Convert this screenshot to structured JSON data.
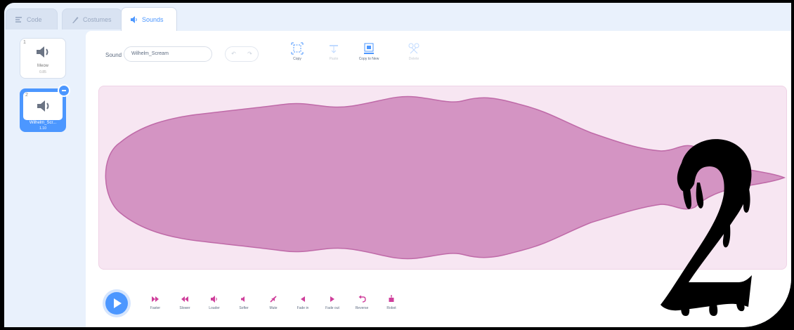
{
  "colors": {
    "accent": "#4c97ff",
    "wave_fill": "#d494c3",
    "wave_bg": "#f7e6f2",
    "effect_icon": "#cf3f9b"
  },
  "tabs": [
    {
      "label": "Code",
      "icon": "code-icon"
    },
    {
      "label": "Costumes",
      "icon": "brush-icon"
    },
    {
      "label": "Sounds",
      "icon": "speaker-icon",
      "active": true
    }
  ],
  "sound_list": [
    {
      "number": "1",
      "name": "Meow",
      "duration": "0.85"
    },
    {
      "number": "2",
      "name": "Wilhelm_Scr...",
      "duration": "1.10",
      "selected": true
    }
  ],
  "editor": {
    "sound_label": "Sound",
    "sound_name": "Wilhelm_Scream",
    "undo_glyph": "↶",
    "redo_glyph": "↷",
    "tools": [
      {
        "label": "Copy",
        "icon": "copy-icon"
      },
      {
        "label": "Paste",
        "icon": "paste-icon",
        "disabled": true
      },
      {
        "label": "Copy to New",
        "icon": "copy-to-new-icon"
      },
      {
        "label": "Delete",
        "icon": "delete-icon",
        "disabled": true
      }
    ]
  },
  "effects": [
    {
      "label": "Faster",
      "icon": "faster-icon"
    },
    {
      "label": "Slower",
      "icon": "slower-icon"
    },
    {
      "label": "Louder",
      "icon": "louder-icon"
    },
    {
      "label": "Softer",
      "icon": "softer-icon"
    },
    {
      "label": "Mute",
      "icon": "mute-icon"
    },
    {
      "label": "Fade in",
      "icon": "fade-in-icon"
    },
    {
      "label": "Fade out",
      "icon": "fade-out-icon"
    },
    {
      "label": "Reverse",
      "icon": "reverse-icon"
    },
    {
      "label": "Robot",
      "icon": "robot-icon"
    }
  ],
  "overlay": {
    "numeral": "2"
  }
}
